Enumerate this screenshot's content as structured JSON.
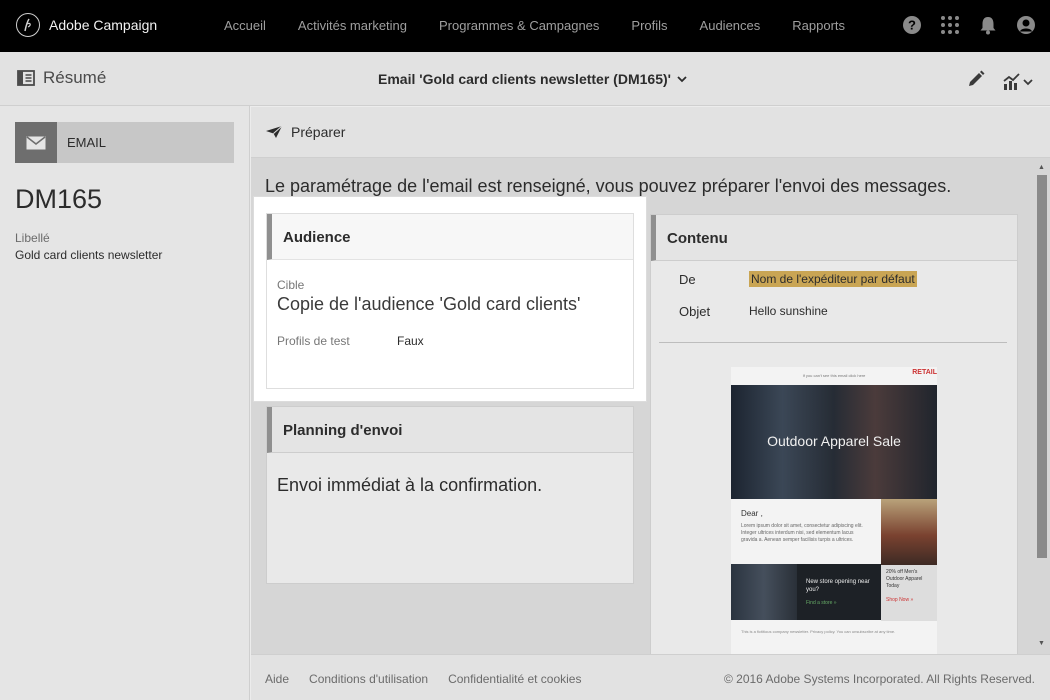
{
  "app": {
    "name": "Adobe Campaign"
  },
  "nav": {
    "items": [
      "Accueil",
      "Activités marketing",
      "Programmes & Campagnes",
      "Profils",
      "Audiences",
      "Rapports"
    ]
  },
  "top_icons": [
    "help-icon",
    "apps-grid-icon",
    "bell-icon",
    "user-avatar-icon"
  ],
  "header": {
    "resume_label": "Résumé",
    "title": "Email 'Gold card clients newsletter (DM165)'"
  },
  "left": {
    "type_label": "EMAIL",
    "code": "DM165",
    "label_key": "Libellé",
    "label_value": "Gold card clients newsletter"
  },
  "toolbar": {
    "prepare_label": "Préparer"
  },
  "main": {
    "message": "Le paramétrage de l'email est renseigné, vous pouvez préparer l'envoi des messages.",
    "audience": {
      "title": "Audience",
      "cible_label": "Cible",
      "cible_value": "Copie de l'audience 'Gold card clients'",
      "test_label": "Profils de test",
      "test_value": "Faux"
    },
    "planning": {
      "title": "Planning d'envoi",
      "text": "Envoi immédiat à la confirmation."
    },
    "content": {
      "title": "Contenu",
      "from_label": "De",
      "from_value": "Nom de l'expéditeur par défaut",
      "subject_label": "Objet",
      "subject_value": "Hello sunshine",
      "preview": {
        "top_text": "If you can't see this email click here",
        "logo": "RETAIL",
        "hero": "Outdoor Apparel Sale",
        "greeting": "Dear ,",
        "lorem": "Lorem ipsum dolor sit amet, consectetur adipiscing elit. Integer ultrices interdum nisi, sed elementum lacus gravida a. Aenean semper facilisis turpis a ultrices.",
        "offer": "20% off Men's Outdoor Apparel Today",
        "shop_link": "Shop Now »",
        "store": "New store opening near you?",
        "store_link": "Find a store »",
        "footer": "This is a fictitious company newsletter. Privacy policy. You can unsubscribe at any time."
      }
    }
  },
  "footer": {
    "links": [
      "Aide",
      "Conditions d'utilisation",
      "Confidentialité et cookies"
    ],
    "copyright": "© 2016 Adobe Systems Incorporated. All Rights Reserved."
  },
  "colors": {
    "topbar": "#000000",
    "highlight": "#c9a554",
    "accent_bar": "#8f8f8f"
  }
}
